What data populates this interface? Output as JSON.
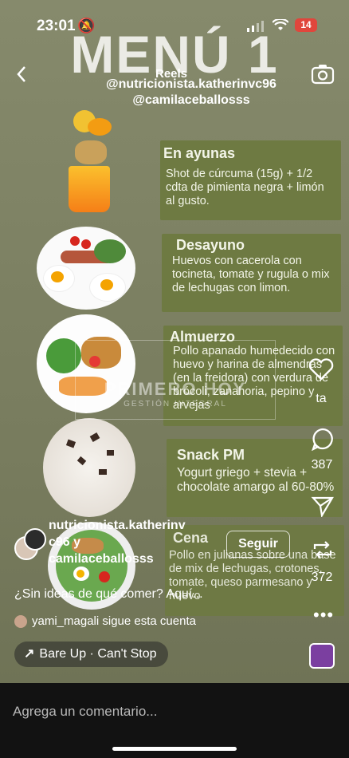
{
  "status": {
    "time": "23:01",
    "battery": "14"
  },
  "header": {
    "reels_label": "Reels"
  },
  "poster": {
    "title": "MENÚ 1",
    "handle_1": "@nutricionista.katherinvc96",
    "handle_2": "@camilaceballosss",
    "sections": [
      {
        "title": "En ayunas",
        "text": "Shot de cúrcuma (15g) + 1/2 cdta de pimienta negra + limón al gusto."
      },
      {
        "title": "Desayuno",
        "text": "Huevos con cacerola con tocineta, tomate y rugula o mix de lechugas con limon."
      },
      {
        "title": "Almuerzo",
        "text": "Pollo apanado humedecido con huevo y harina de almendras (en la freidora) con verdura de brócoli, zanahoria, pepino y arvejas"
      },
      {
        "title": "Snack PM",
        "text": "Yogurt griego + stevia + chocolate amargo al 60-80%"
      },
      {
        "title": "Cena",
        "text": "Pollo en julianas sobre una base de mix de lechugas, crotones, tomate, queso parmesano y huevo"
      }
    ],
    "watermark": "PRIMERO HOY",
    "watermark_sub": "GESTIÓN INTEGRAL"
  },
  "actions": {
    "like_count": "ta",
    "comment_count": "387",
    "repost_count": "372"
  },
  "post": {
    "authors_line1": "nutricionista.katherinv",
    "authors_line2": "c96 y",
    "authors_line3": "camilaceballosss",
    "follow_label": "Seguir",
    "caption": "¿Sin ideas de qué comer? Aquí...",
    "follower_user": "yami_magali",
    "follower_text": "sigue esta cuenta",
    "audio": "Bare Up · Can't Stop"
  },
  "comment": {
    "placeholder": "Agrega un comentario..."
  },
  "colors": {
    "card": "#6e7a42",
    "background": "#7d8163",
    "bottom_bar": "#121212"
  }
}
